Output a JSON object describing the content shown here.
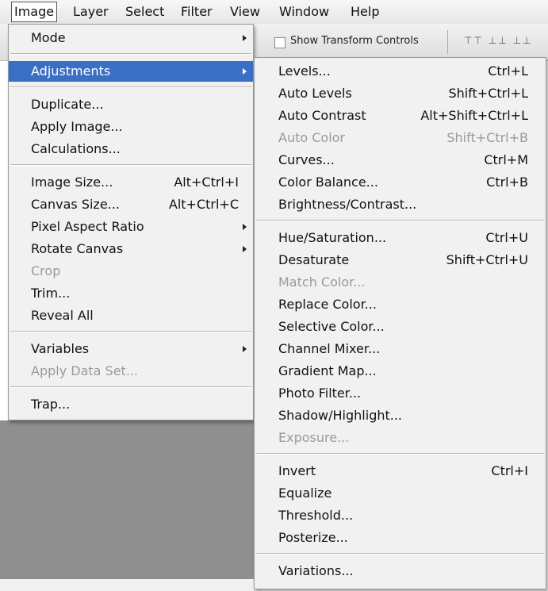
{
  "menubar": [
    {
      "label": "Image",
      "active": true
    },
    {
      "label": "Layer"
    },
    {
      "label": "Select"
    },
    {
      "label": "Filter"
    },
    {
      "label": "View"
    },
    {
      "label": "Window"
    },
    {
      "label": "Help"
    }
  ],
  "optionsbar": {
    "show_transform_label": "Show Transform Controls",
    "align_icons": "⊤⊤ ⊥⊥ ⊥⊥"
  },
  "image_menu": {
    "items": [
      {
        "label": "Mode",
        "submenu": true
      },
      {
        "label": "Adjustments",
        "submenu": true,
        "highlighted": true
      },
      {
        "label": "Duplicate..."
      },
      {
        "label": "Apply Image..."
      },
      {
        "label": "Calculations..."
      },
      {
        "label": "Image Size...",
        "shortcut": "Alt+Ctrl+I"
      },
      {
        "label": "Canvas Size...",
        "shortcut": "Alt+Ctrl+C"
      },
      {
        "label": "Pixel Aspect Ratio",
        "submenu": true
      },
      {
        "label": "Rotate Canvas",
        "submenu": true
      },
      {
        "label": "Crop",
        "disabled": true
      },
      {
        "label": "Trim..."
      },
      {
        "label": "Reveal All"
      },
      {
        "label": "Variables",
        "submenu": true
      },
      {
        "label": "Apply Data Set...",
        "disabled": true
      },
      {
        "label": "Trap..."
      }
    ]
  },
  "adjustments_menu": {
    "items": [
      {
        "label": "Levels...",
        "shortcut": "Ctrl+L"
      },
      {
        "label": "Auto Levels",
        "shortcut": "Shift+Ctrl+L"
      },
      {
        "label": "Auto Contrast",
        "shortcut": "Alt+Shift+Ctrl+L"
      },
      {
        "label": "Auto Color",
        "shortcut": "Shift+Ctrl+B",
        "disabled": true
      },
      {
        "label": "Curves...",
        "shortcut": "Ctrl+M"
      },
      {
        "label": "Color Balance...",
        "shortcut": "Ctrl+B"
      },
      {
        "label": "Brightness/Contrast..."
      },
      {
        "label": "Hue/Saturation...",
        "shortcut": "Ctrl+U"
      },
      {
        "label": "Desaturate",
        "shortcut": "Shift+Ctrl+U"
      },
      {
        "label": "Match Color...",
        "disabled": true
      },
      {
        "label": "Replace Color..."
      },
      {
        "label": "Selective Color..."
      },
      {
        "label": "Channel Mixer..."
      },
      {
        "label": "Gradient Map..."
      },
      {
        "label": "Photo Filter..."
      },
      {
        "label": "Shadow/Highlight..."
      },
      {
        "label": "Exposure...",
        "disabled": true
      },
      {
        "label": "Invert",
        "shortcut": "Ctrl+I"
      },
      {
        "label": "Equalize"
      },
      {
        "label": "Threshold..."
      },
      {
        "label": "Posterize..."
      },
      {
        "label": "Variations..."
      }
    ]
  }
}
